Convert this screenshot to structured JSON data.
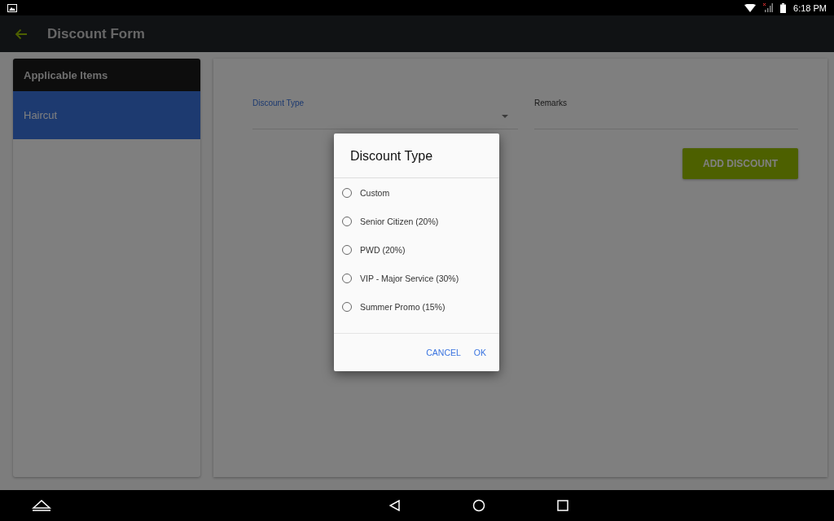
{
  "status_bar": {
    "time": "6:18 PM"
  },
  "app_bar": {
    "title": "Discount Form"
  },
  "sidebar": {
    "header": "Applicable Items",
    "items": [
      {
        "label": "Haircut",
        "selected": true
      }
    ]
  },
  "form": {
    "discount_type": {
      "label": "Discount Type"
    },
    "remarks": {
      "label": "Remarks"
    },
    "add_button": "ADD DISCOUNT"
  },
  "dialog": {
    "title": "Discount Type",
    "options": [
      {
        "label": "Custom",
        "selected": false
      },
      {
        "label": "Senior Citizen (20%)",
        "selected": false
      },
      {
        "label": "PWD (20%)",
        "selected": false
      },
      {
        "label": "VIP - Major Service (30%)",
        "selected": false
      },
      {
        "label": "Summer Promo (15%)",
        "selected": false
      }
    ],
    "buttons": [
      "CANCEL",
      "OK"
    ]
  }
}
